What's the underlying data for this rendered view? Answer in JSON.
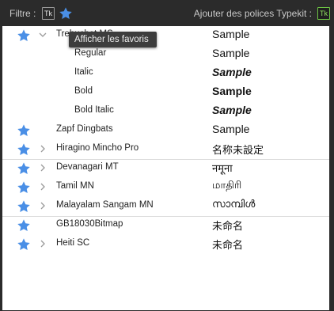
{
  "topbar": {
    "filter_label": "Filtre :",
    "tk_filter_text": "Tk",
    "typekit_label": "Ajouter des polices Typekit :",
    "tk_typekit_text": "Tk"
  },
  "tooltip": "Afficher les favoris",
  "fonts": [
    {
      "name": "Trebuchet MS",
      "sample": "Sample",
      "favorite": true,
      "chevron": "down",
      "sub": false,
      "cjk": false
    },
    {
      "name": "Regular",
      "sample": "Sample",
      "favorite": false,
      "chevron": "none",
      "sub": true,
      "cjk": false
    },
    {
      "name": "Italic",
      "sample": "Sample",
      "favorite": false,
      "chevron": "none",
      "sub": true,
      "cjk": false
    },
    {
      "name": "Bold",
      "sample": "Sample",
      "favorite": false,
      "chevron": "none",
      "sub": true,
      "cjk": false
    },
    {
      "name": "Bold Italic",
      "sample": "Sample",
      "favorite": false,
      "chevron": "none",
      "sub": true,
      "cjk": false
    },
    {
      "name": "Zapf Dingbats",
      "sample": "Sample",
      "favorite": true,
      "chevron": "none",
      "sub": false,
      "cjk": false
    },
    {
      "name": "Hiragino Mincho Pro",
      "sample": "名称未設定",
      "favorite": true,
      "chevron": "right",
      "sub": false,
      "cjk": true
    },
    {
      "name": "Devanagari MT",
      "sample": "नमूना",
      "favorite": true,
      "chevron": "right",
      "sub": false,
      "cjk": true
    },
    {
      "name": "Tamil MN",
      "sample": "மாதிரி",
      "favorite": true,
      "chevron": "right",
      "sub": false,
      "cjk": true
    },
    {
      "name": "Malayalam Sangam MN",
      "sample": "സാമ്പിൾ",
      "favorite": true,
      "chevron": "right",
      "sub": false,
      "cjk": true
    },
    {
      "name": "GB18030Bitmap",
      "sample": "未命名",
      "favorite": true,
      "chevron": "none",
      "sub": false,
      "cjk": true
    },
    {
      "name": "Heiti SC",
      "sample": "未命名",
      "favorite": true,
      "chevron": "right",
      "sub": false,
      "cjk": true
    }
  ],
  "colors": {
    "star": "#4a8fe6",
    "typekit_green": "#6ec545",
    "topbar_bg": "#2b2b2b"
  }
}
